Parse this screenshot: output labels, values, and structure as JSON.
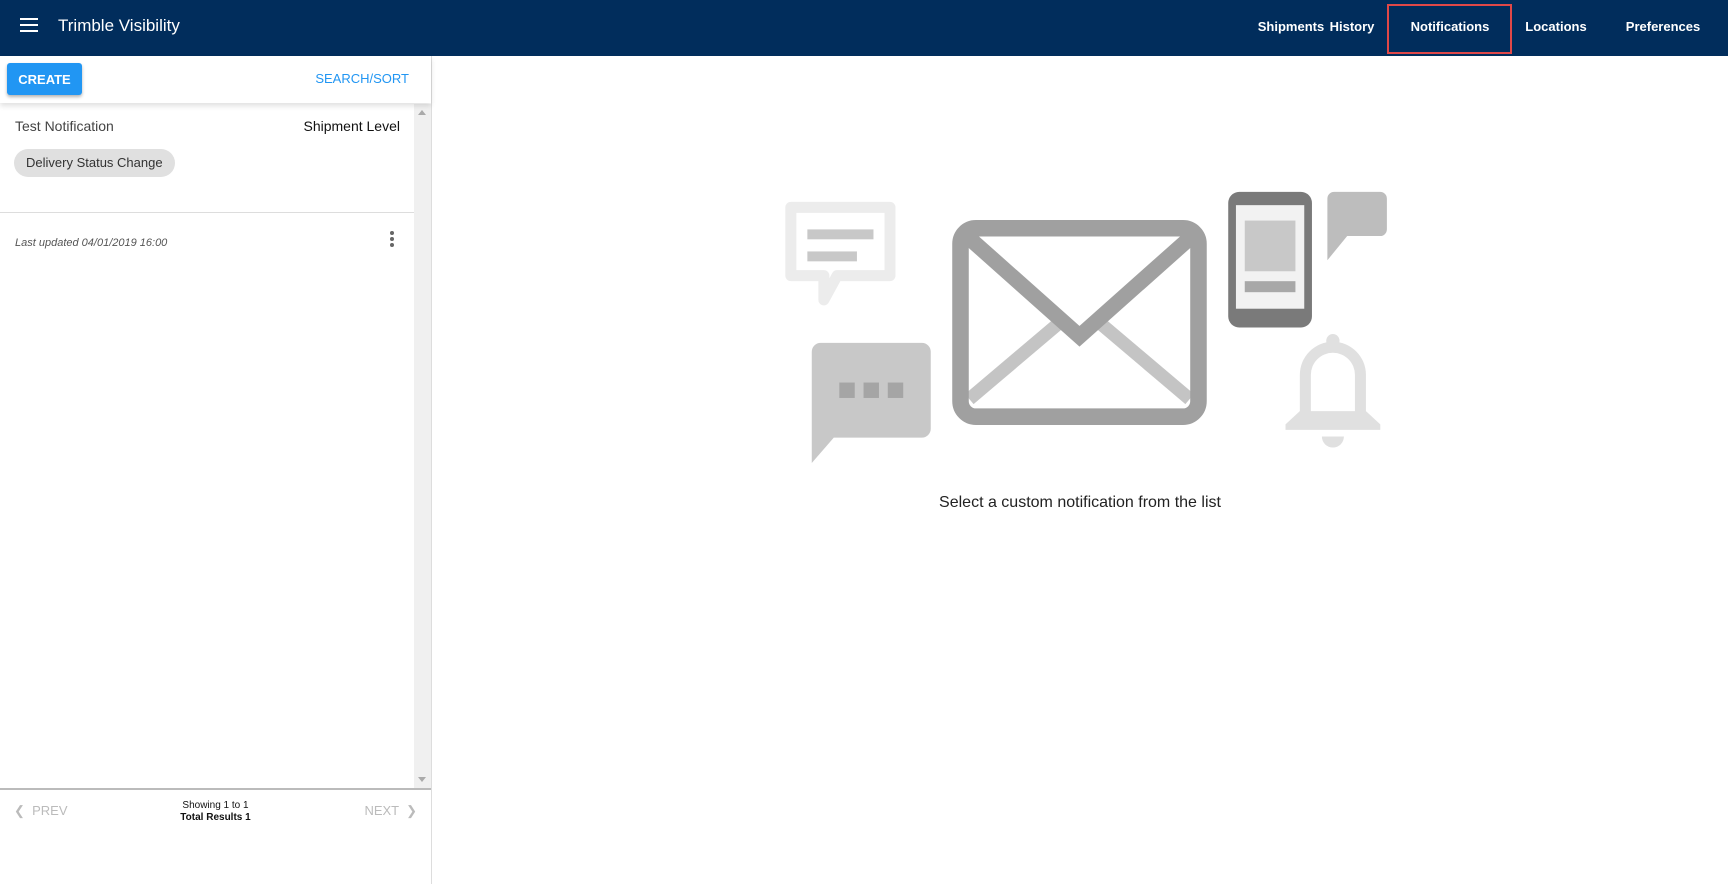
{
  "header": {
    "title": "Trimble Visibility",
    "nav": [
      "Shipments",
      "History",
      "Notifications",
      "Locations",
      "Preferences"
    ],
    "active": "Notifications"
  },
  "sidebar": {
    "create_label": "CREATE",
    "search_label": "SEARCH/SORT",
    "items": [
      {
        "name": "Test Notification",
        "level": "Shipment Level",
        "chip": "Delivery Status Change",
        "updated": "Last updated 04/01/2019 16:00"
      }
    ],
    "pager": {
      "prev": "PREV",
      "next": "NEXT",
      "showing": "Showing 1 to 1",
      "total": "Total Results 1"
    }
  },
  "main": {
    "message": "Select a custom notification from the list"
  },
  "colors": {
    "header": "#012d5c",
    "accent": "#2196f3",
    "highlight": "#e04848"
  }
}
